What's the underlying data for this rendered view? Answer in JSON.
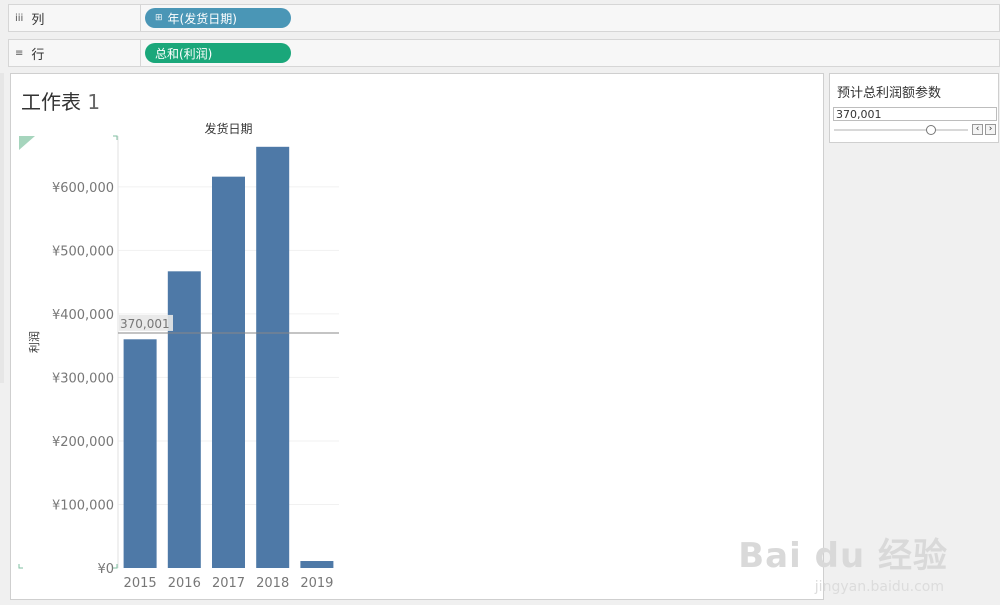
{
  "shelves": {
    "columns": {
      "icon": "iii",
      "label": "列",
      "pill": "年(发货日期)",
      "pill_icon": "⊞"
    },
    "rows": {
      "icon": "≡",
      "label": "行",
      "pill": "总和(利润)"
    }
  },
  "sheet": {
    "title": "工作表",
    "title_num": "1"
  },
  "parameter": {
    "title": "预计总利润额参数",
    "value": "370,001",
    "slider_fraction": 0.74
  },
  "colors": {
    "bar": "#4e79a7",
    "pill_blue": "#4a96b6",
    "pill_green": "#1aa77a"
  },
  "chart_data": {
    "type": "bar",
    "title": "发货日期",
    "ylabel": "利润",
    "categories": [
      "2015",
      "2016",
      "2017",
      "2018",
      "2019"
    ],
    "values": [
      360000,
      467000,
      616000,
      663000,
      11000
    ],
    "ylim": [
      0,
      680000
    ],
    "yticks": [
      0,
      100000,
      200000,
      300000,
      400000,
      500000,
      600000
    ],
    "ytick_labels": [
      "¥0",
      "¥100,000",
      "¥200,000",
      "¥300,000",
      "¥400,000",
      "¥500,000",
      "¥600,000"
    ],
    "reference_line": {
      "value": 370001,
      "label": "370,001"
    },
    "grid": true
  },
  "watermark": {
    "main": "Bai du 经验",
    "sub": "jingyan.baidu.com"
  }
}
